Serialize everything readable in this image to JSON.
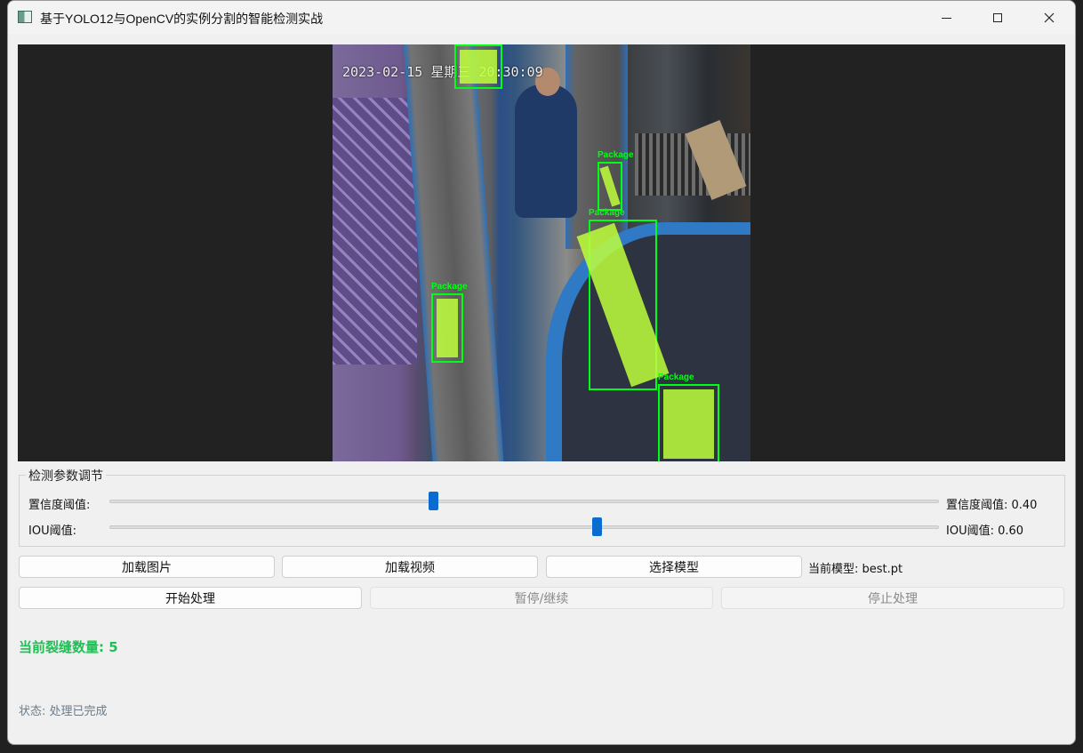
{
  "window": {
    "title": "基于YOLO12与OpenCV的实例分割的智能检测实战",
    "controls": [
      "minimize",
      "maximize",
      "close"
    ]
  },
  "viewer": {
    "timestamp": "2023-02-15 星期三 20:30:09",
    "detections": [
      {
        "label": "Package"
      },
      {
        "label": "Package"
      },
      {
        "label": "Package"
      },
      {
        "label": "Package"
      },
      {
        "label": ""
      }
    ],
    "mask_color": "#beff3c",
    "box_color": "#00ff14"
  },
  "params": {
    "group_title": "检测参数调节",
    "confidence": {
      "label": "置信度阈值:",
      "value_text": "置信度阈值: 0.40",
      "value": 0.4
    },
    "iou": {
      "label": "IOU阈值:",
      "value_text": "IOU阈值: 0.60",
      "value": 0.6
    },
    "slider_color": "#0a6bd1"
  },
  "buttons": {
    "load_image": "加载图片",
    "load_video": "加载视频",
    "select_model": "选择模型",
    "start": "开始处理",
    "pause": "暂停/继续",
    "stop": "停止处理"
  },
  "model_info": "当前模型: best.pt",
  "count_text": "当前裂缝数量: 5",
  "count_color": "#1fbf55",
  "status_text": "状态: 处理已完成"
}
